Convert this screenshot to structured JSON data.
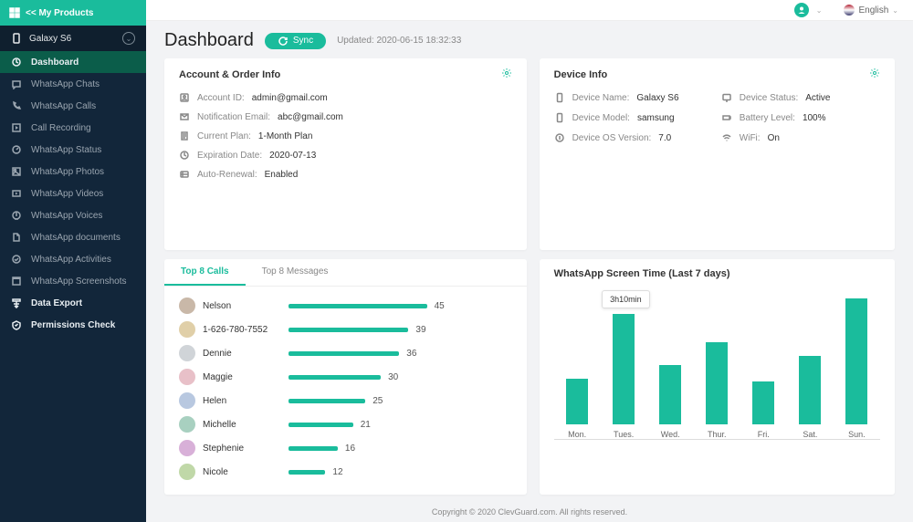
{
  "header": {
    "my_products": "<< My Products",
    "language": "English"
  },
  "device_selector": {
    "name": "Galaxy S6"
  },
  "sidebar": {
    "items": [
      {
        "label": "Dashboard",
        "active": true,
        "bold": true
      },
      {
        "label": "WhatsApp Chats"
      },
      {
        "label": "WhatsApp Calls"
      },
      {
        "label": "Call Recording"
      },
      {
        "label": "WhatsApp Status"
      },
      {
        "label": "WhatsApp Photos"
      },
      {
        "label": "WhatsApp Videos"
      },
      {
        "label": "WhatsApp Voices"
      },
      {
        "label": "WhatsApp documents"
      },
      {
        "label": "WhatsApp Activities"
      },
      {
        "label": "WhatsApp Screenshots"
      },
      {
        "label": "Data Export",
        "bold": true
      },
      {
        "label": "Permissions Check",
        "bold": true
      }
    ]
  },
  "page": {
    "title": "Dashboard",
    "sync": "Sync",
    "updated": "Updated: 2020-06-15 18:32:33"
  },
  "account_card": {
    "title": "Account & Order Info",
    "rows": [
      {
        "label": "Account ID:",
        "value": "admin@gmail.com"
      },
      {
        "label": "Notification Email:",
        "value": "abc@gmail.com"
      },
      {
        "label": "Current Plan:",
        "value": "1-Month Plan"
      },
      {
        "label": "Expiration Date:",
        "value": "2020-07-13"
      },
      {
        "label": "Auto-Renewal:",
        "value": "Enabled"
      }
    ]
  },
  "device_card": {
    "title": "Device Info",
    "rows": [
      {
        "label": "Device Name:",
        "value": "Galaxy S6"
      },
      {
        "label": "Device Status:",
        "value": "Active"
      },
      {
        "label": "Device Model:",
        "value": "samsung"
      },
      {
        "label": "Battery Level:",
        "value": "100%"
      },
      {
        "label": "Device OS Version:",
        "value": "7.0"
      },
      {
        "label": "WiFi:",
        "value": "On"
      }
    ]
  },
  "tabs": {
    "calls": "Top 8 Calls",
    "messages": "Top 8 Messages"
  },
  "calls": [
    {
      "name": "Nelson",
      "value": 45
    },
    {
      "name": "1-626-780-7552",
      "value": 39
    },
    {
      "name": "Dennie",
      "value": 36
    },
    {
      "name": "Maggie",
      "value": 30
    },
    {
      "name": "Helen",
      "value": 25
    },
    {
      "name": "Michelle",
      "value": 21
    },
    {
      "name": "Stephenie",
      "value": 16
    },
    {
      "name": "Nicole",
      "value": 12
    }
  ],
  "screentime": {
    "title": "WhatsApp Screen Time (Last 7 days)",
    "tooltip": "3h10min"
  },
  "chart_data": {
    "type": "bar",
    "title": "WhatsApp Screen Time (Last 7 days)",
    "categories": [
      "Mon.",
      "Tues.",
      "Wed.",
      "Thur.",
      "Fri.",
      "Sat.",
      "Sun."
    ],
    "values": [
      54,
      130,
      70,
      96,
      50,
      80,
      148
    ],
    "tooltip_index": 1,
    "tooltip_value": "3h10min",
    "ylim": [
      0,
      150
    ]
  },
  "footer": "Copyright © 2020 ClevGuard.com. All rights reserved.",
  "avatar_colors": [
    "#c9b8a8",
    "#e0cfa8",
    "#d0d4d8",
    "#e8c0c8",
    "#b8c8e0",
    "#a8d0c0",
    "#d8b0d8",
    "#c0d8a8"
  ]
}
